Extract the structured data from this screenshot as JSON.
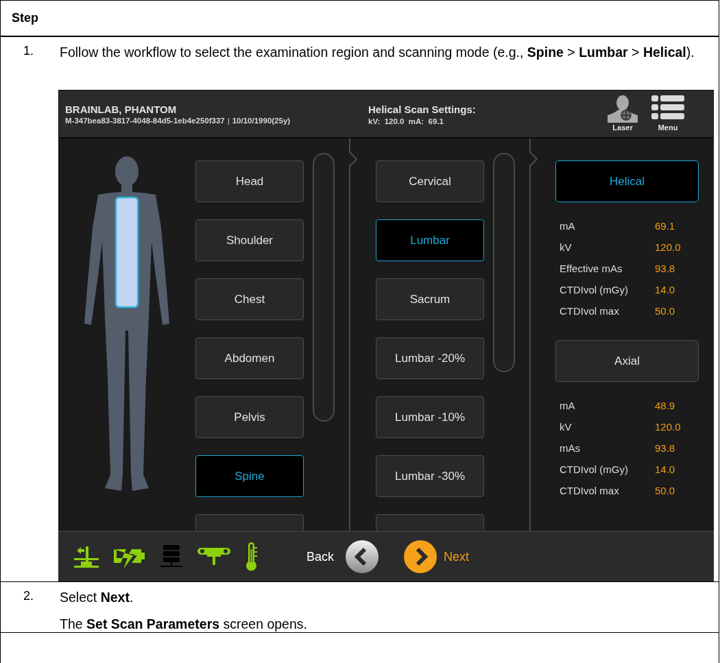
{
  "table": {
    "header": "Step",
    "steps": [
      {
        "number": "1.",
        "paragraphs": [
          "Follow the workflow to select the examination region and scanning mode (e.g., **Spine** > **Lumbar** > **Helical**)."
        ],
        "screen": {
          "header": {
            "patient_name": "BRAINLAB, PHANTOM",
            "patient_id": "M-347bea83-3817-4048-84d5-1eb4e250f337",
            "separator": "|",
            "birth_date": "10/10/1990(25y)",
            "settings_title": "Helical Scan Settings:",
            "settings_values": "kV:  120.0  mA:  69.1",
            "laser_label": "Laser",
            "menu_label": "Menu"
          },
          "regions": [
            {
              "label": "Head",
              "selected": false
            },
            {
              "label": "Shoulder",
              "selected": false
            },
            {
              "label": "Chest",
              "selected": false
            },
            {
              "label": "Abdomen",
              "selected": false
            },
            {
              "label": "Pelvis",
              "selected": false
            },
            {
              "label": "Spine",
              "selected": true
            }
          ],
          "protocols": [
            {
              "label": "Cervical",
              "selected": false
            },
            {
              "label": "Lumbar",
              "selected": true
            },
            {
              "label": "Sacrum",
              "selected": false
            },
            {
              "label": "Lumbar -20%",
              "selected": false
            },
            {
              "label": "Lumbar -10%",
              "selected": false
            },
            {
              "label": "Lumbar -30%",
              "selected": false
            }
          ],
          "modes": [
            {
              "label": "Helical",
              "selected": true,
              "params": [
                {
                  "label": "mA",
                  "value": "69.1"
                },
                {
                  "label": "kV",
                  "value": "120.0"
                },
                {
                  "label": "Effective mAs",
                  "value": "93.8"
                },
                {
                  "label": "CTDIvol (mGy)",
                  "value": "14.0"
                },
                {
                  "label": "CTDIvol max",
                  "value": "50.0"
                }
              ]
            },
            {
              "label": "Axial",
              "selected": false,
              "params": [
                {
                  "label": "mA",
                  "value": "48.9"
                },
                {
                  "label": "kV",
                  "value": "120.0"
                },
                {
                  "label": "mAs",
                  "value": "93.8"
                },
                {
                  "label": "CTDIvol (mGy)",
                  "value": "14.0"
                },
                {
                  "label": "CTDIvol max",
                  "value": "50.0"
                }
              ]
            }
          ],
          "footer": {
            "status_icons": [
              {
                "kind": "table"
              },
              {
                "kind": "battery"
              },
              {
                "kind": "server"
              },
              {
                "kind": "gantry"
              },
              {
                "kind": "thermometer"
              }
            ],
            "back_label": "Back",
            "next_label": "Next"
          }
        }
      },
      {
        "number": "2.",
        "paragraphs": [
          "Select **Next**.",
          "The **Set Scan Parameters** screen opens."
        ]
      }
    ]
  }
}
